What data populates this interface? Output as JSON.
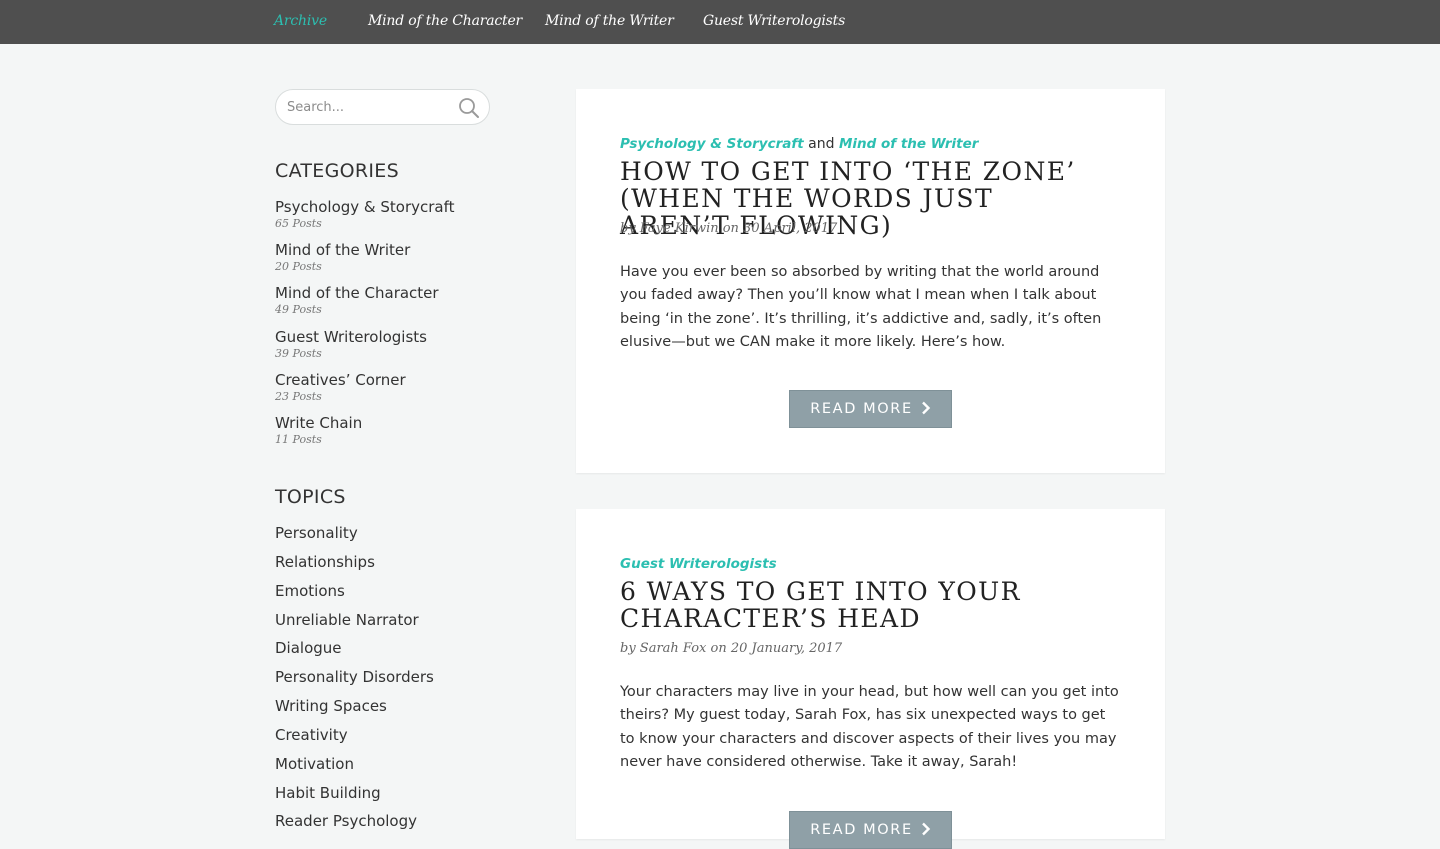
{
  "nav": {
    "items": [
      {
        "label": "Archive",
        "active": true
      },
      {
        "label": "Mind of the Character",
        "active": false
      },
      {
        "label": "Mind of the Writer",
        "active": false
      },
      {
        "label": "Guest Writerologists",
        "active": false
      }
    ]
  },
  "sidebar": {
    "search": {
      "placeholder": "Search...",
      "value": ""
    },
    "categories_heading": "CATEGORIES",
    "categories": [
      {
        "name": "Psychology & Storycraft",
        "count": "65 Posts"
      },
      {
        "name": "Mind of the Writer",
        "count": "20 Posts"
      },
      {
        "name": "Mind of the Character",
        "count": "49 Posts"
      },
      {
        "name": "Guest Writerologists",
        "count": "39 Posts"
      },
      {
        "name": "Creatives’ Corner",
        "count": "23 Posts"
      },
      {
        "name": "Write Chain",
        "count": "11 Posts"
      }
    ],
    "topics_heading": "TOPICS",
    "topics": [
      "Personality",
      "Relationships",
      "Emotions",
      "Unreliable Narrator",
      "Dialogue",
      "Personality Disorders",
      "Writing Spaces",
      "Creativity",
      "Motivation",
      "Habit Building",
      "Reader Psychology"
    ]
  },
  "posts": [
    {
      "categories": [
        "Psychology & Storycraft",
        "Mind of the Writer"
      ],
      "joiner": "and",
      "title": "How to Get into ‘The Zone’ (When the Words Just Aren’t Flowing)",
      "meta": "by Faye Kirwin on 30 April, 2017",
      "excerpt": "Have you ever been so absorbed by writing that the world around you faded away? Then you’ll know what I mean when I talk about being ‘in the zone’. It’s thrilling, it’s addictive and, sadly, it’s often elusive—but we CAN make it more likely. Here’s how.",
      "button": "Read More"
    },
    {
      "categories": [
        "Guest Writerologists"
      ],
      "title": "6 Ways to Get into Your Character’s Head",
      "meta": "by Sarah Fox on 20 January, 2017",
      "excerpt": "Your characters may live in your head, but how well can you get into theirs? My guest today, Sarah Fox, has six unexpected ways to get to know your characters and discover aspects of their lives you may never have considered otherwise. Take it away, Sarah!",
      "button": "Read More"
    }
  ],
  "colors": {
    "nav_bg": "#4f4f4f",
    "accent": "#2cbfb1",
    "button_bg": "#8fa0a7",
    "page_bg": "#f4f6f6"
  }
}
